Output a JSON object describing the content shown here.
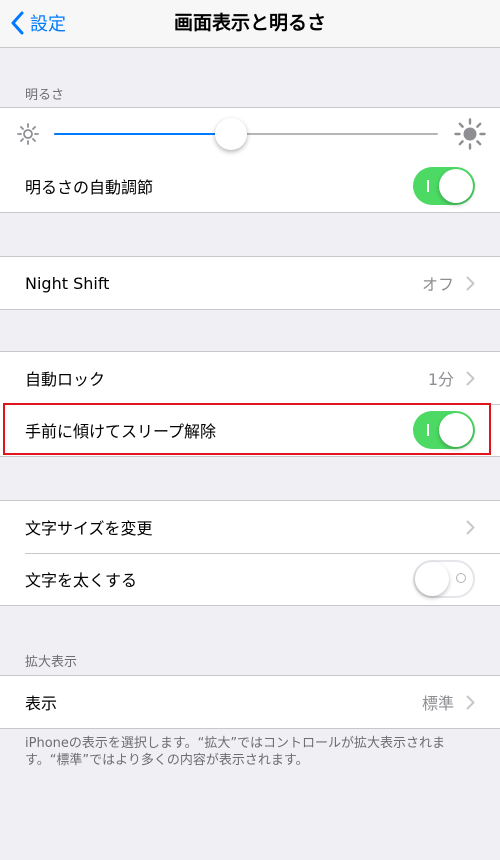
{
  "navbar": {
    "back_label": "設定",
    "title": "画面表示と明るさ"
  },
  "brightness": {
    "header": "明るさ",
    "slider_level": 0.46,
    "auto_label": "明るさの自動調節",
    "auto_on": true
  },
  "night_shift": {
    "label": "Night Shift",
    "value": "オフ"
  },
  "lock": {
    "auto_lock_label": "自動ロック",
    "auto_lock_value": "1分",
    "raise_to_wake_label": "手前に傾けてスリープ解除",
    "raise_to_wake_on": true
  },
  "text": {
    "size_label": "文字サイズを変更",
    "bold_label": "文字を太くする",
    "bold_on": false
  },
  "zoom": {
    "header": "拡大表示",
    "view_label": "表示",
    "view_value": "標準",
    "footer": "iPhoneの表示を選択します。“拡大”ではコントロールが拡大表示されます。“標準”ではより多くの内容が表示されます。"
  },
  "colors": {
    "accent": "#007aff",
    "toggle_on": "#4cd964",
    "highlight": "#e0141e",
    "background": "#efeff4"
  }
}
